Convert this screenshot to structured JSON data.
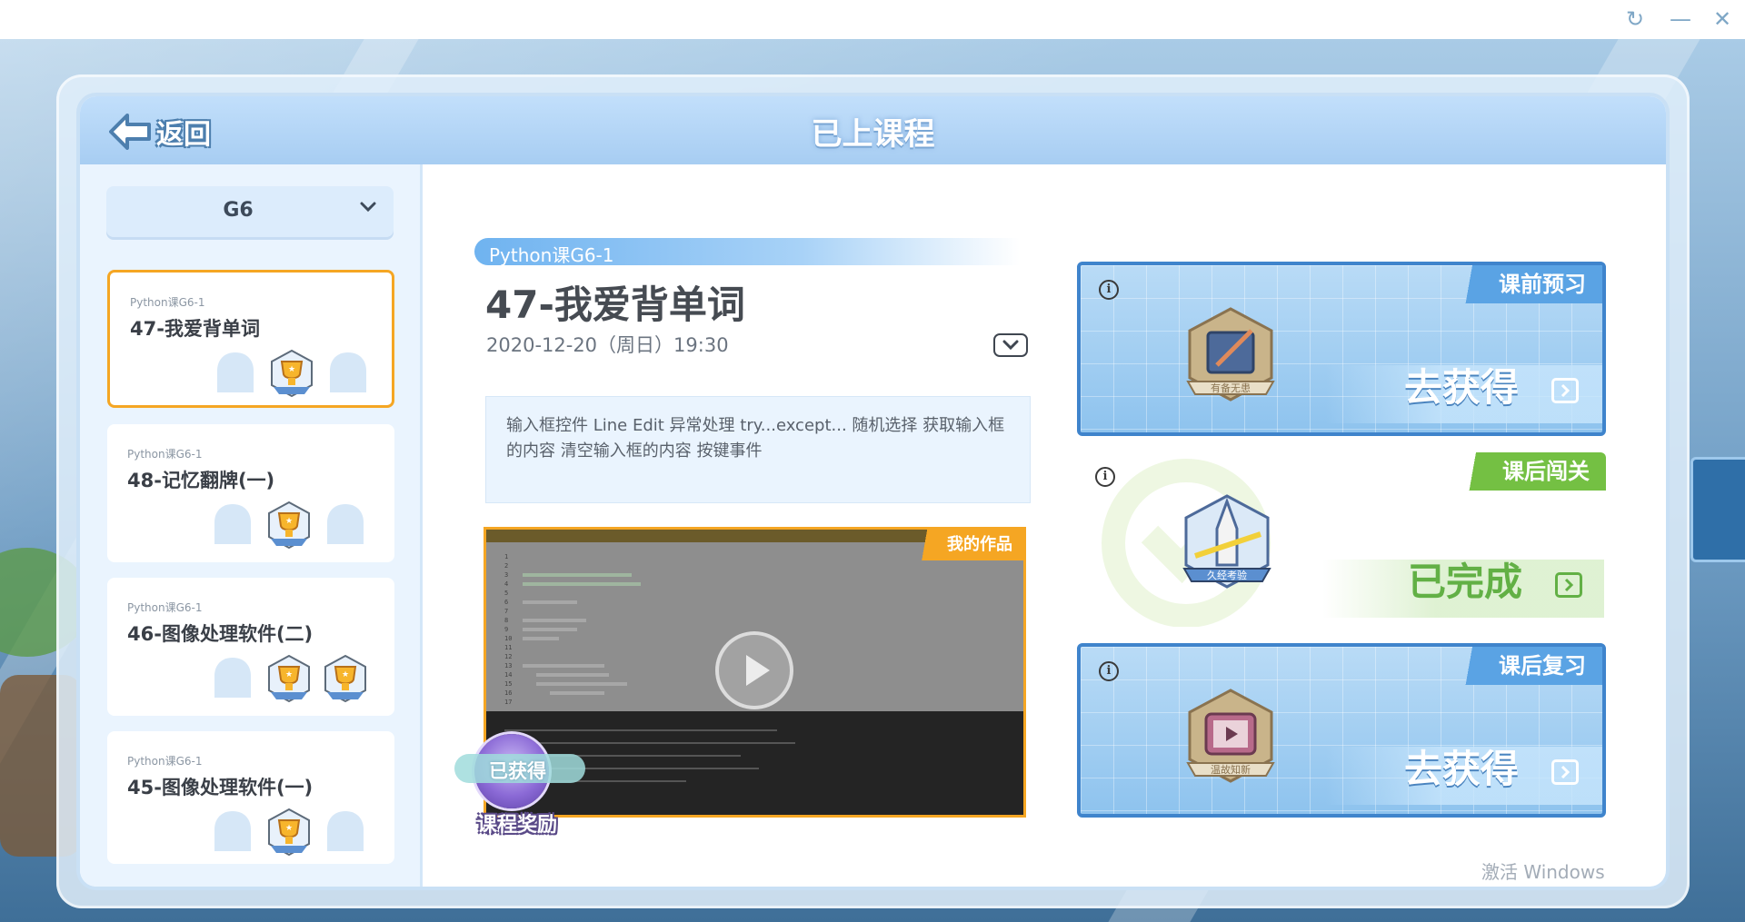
{
  "window": {
    "refresh_icon": "↻",
    "minimize_icon": "—",
    "close_icon": "✕"
  },
  "header": {
    "back_label": "返回",
    "title": "已上课程"
  },
  "sidebar": {
    "grade": "G6",
    "lessons": [
      {
        "course": "Python课G6-1",
        "title": "47-我爱背单词",
        "active": true,
        "badges_earned": 1
      },
      {
        "course": "Python课G6-1",
        "title": "48-记忆翻牌(一)",
        "active": false,
        "badges_earned": 1
      },
      {
        "course": "Python课G6-1",
        "title": "46-图像处理软件(二)",
        "active": false,
        "badges_earned": 2
      },
      {
        "course": "Python课G6-1",
        "title": "45-图像处理软件(一)",
        "active": false,
        "badges_earned": 1
      }
    ]
  },
  "detail": {
    "course_tag": "Python课G6-1",
    "title": "47-我爱背单词",
    "date": "2020-12-20（周日）19:30",
    "description": "输入框控件 Line Edit 异常处理 try...except... 随机选择 获取输入框的内容 清空输入框的内容 按键事件",
    "video_tag": "我的作品",
    "reward_status": "已获得",
    "reward_label": "课程奖励"
  },
  "cards": [
    {
      "tag": "课前预习",
      "action": "去获得",
      "medal_text": "有备无患",
      "status": "pending"
    },
    {
      "tag": "课后闯关",
      "action": "已完成",
      "medal_text": "久经考验",
      "status": "done"
    },
    {
      "tag": "课后复习",
      "action": "去获得",
      "medal_text": "温故知新",
      "status": "pending"
    }
  ],
  "watermark": "激活 Windows",
  "colors": {
    "accent_orange": "#f5a623",
    "header_blue": "#a7cdf2",
    "card_blue_border": "#3f84cc",
    "done_green": "#74c043"
  }
}
